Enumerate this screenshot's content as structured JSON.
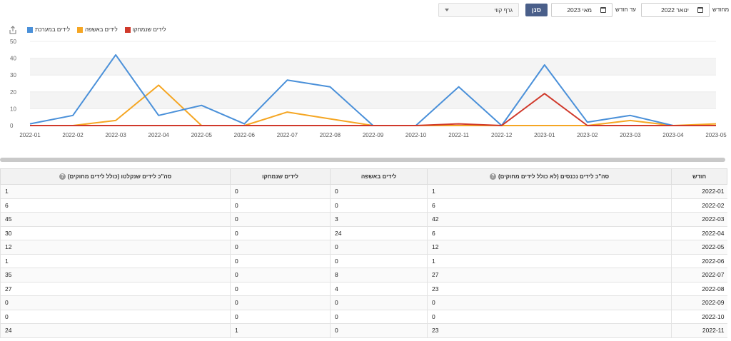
{
  "filters": {
    "from_label": "מחודש",
    "from_value": "ינואר 2022",
    "to_label": "עד חודש",
    "to_value": "מאי 2023",
    "filter_button": "סנן",
    "chart_type_value": "גרף קווי"
  },
  "colors": {
    "blue": "#4a90d9",
    "orange": "#f5a623",
    "red": "#d0392b"
  },
  "chart_data": {
    "type": "line",
    "x": [
      "2022-01",
      "2022-02",
      "2022-03",
      "2022-04",
      "2022-05",
      "2022-06",
      "2022-07",
      "2022-08",
      "2022-09",
      "2022-10",
      "2022-11",
      "2022-12",
      "2023-01",
      "2023-02",
      "2023-03",
      "2023-04",
      "2023-05"
    ],
    "ylim": [
      0,
      50
    ],
    "yticks": [
      0,
      10,
      20,
      30,
      40,
      50
    ],
    "series": [
      {
        "name": "לידים במערכת",
        "color": "#4a90d9",
        "values": [
          1,
          6,
          42,
          6,
          12,
          1,
          27,
          23,
          0,
          0,
          23,
          0,
          36,
          2,
          6,
          0,
          0
        ]
      },
      {
        "name": "לידים באשפה",
        "color": "#f5a623",
        "values": [
          0,
          0,
          3,
          24,
          0,
          0,
          8,
          4,
          0,
          0,
          0,
          0,
          0,
          0,
          3,
          0,
          1
        ]
      },
      {
        "name": "לידים שנמחקו",
        "color": "#d0392b",
        "values": [
          0,
          0,
          0,
          0,
          0,
          0,
          0,
          0,
          0,
          0,
          1,
          0,
          19,
          0,
          0,
          0,
          0
        ]
      }
    ],
    "legend_position": "top-left",
    "grid": true
  },
  "table": {
    "headers": {
      "month": "חודש",
      "entered": "סה\"כ לידים נכנסים (לא כולל לידים מחוקים)",
      "trash": "לידים באשפה",
      "deleted": "לידים שנמחקו",
      "total": "סה\"כ לידים שנקלטו (כולל לידים מחוקים)"
    },
    "help_glyph": "?",
    "rows": [
      {
        "month": "2022-01",
        "entered": "1",
        "trash": "0",
        "deleted": "0",
        "total": "1"
      },
      {
        "month": "2022-02",
        "entered": "6",
        "trash": "0",
        "deleted": "0",
        "total": "6"
      },
      {
        "month": "2022-03",
        "entered": "42",
        "trash": "3",
        "deleted": "0",
        "total": "45"
      },
      {
        "month": "2022-04",
        "entered": "6",
        "trash": "24",
        "deleted": "0",
        "total": "30"
      },
      {
        "month": "2022-05",
        "entered": "12",
        "trash": "0",
        "deleted": "0",
        "total": "12"
      },
      {
        "month": "2022-06",
        "entered": "1",
        "trash": "0",
        "deleted": "0",
        "total": "1"
      },
      {
        "month": "2022-07",
        "entered": "27",
        "trash": "8",
        "deleted": "0",
        "total": "35"
      },
      {
        "month": "2022-08",
        "entered": "23",
        "trash": "4",
        "deleted": "0",
        "total": "27"
      },
      {
        "month": "2022-09",
        "entered": "0",
        "trash": "0",
        "deleted": "0",
        "total": "0"
      },
      {
        "month": "2022-10",
        "entered": "0",
        "trash": "0",
        "deleted": "0",
        "total": "0"
      },
      {
        "month": "2022-11",
        "entered": "23",
        "trash": "0",
        "deleted": "1",
        "total": "24"
      }
    ]
  }
}
